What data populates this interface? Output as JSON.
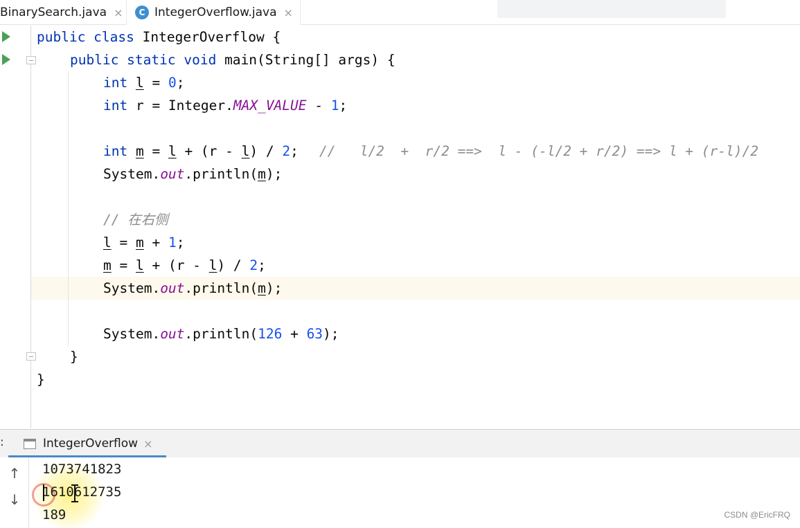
{
  "tabs": [
    {
      "label": "BinarySearch.java",
      "close": "×"
    },
    {
      "label": "IntegerOverflow.java",
      "close": "×",
      "icon": "C"
    }
  ],
  "editor": {
    "lines": [
      "public class IntegerOverflow {",
      "public static void main(String[] args) {",
      "int l = 0;",
      "int r = Integer.MAX_VALUE - 1;",
      "int m = l + (r - l) / 2;",
      "//   l/2  +  r/2 ==>  l - (-l/2 + r/2) ==> l + (r-l)/2",
      "System.out.println(m);",
      "// 在右侧",
      "l = m + 1;",
      "m = l + (r - l) / 2;",
      "System.out.println(m);",
      "System.out.println(126 + 63);",
      "}",
      "}"
    ]
  },
  "run": {
    "panel_label": ":",
    "tab_label": "IntegerOverflow",
    "tab_close": "×",
    "side_up": "↑",
    "side_down": "↓",
    "output": [
      "1073741823",
      "1610612735",
      "189"
    ]
  },
  "watermark": "CSDN @EricFRQ",
  "colors": {
    "keyword": "#0033b3",
    "number": "#1750eb",
    "field": "#871094",
    "comment": "#8c8c8c",
    "run_icon": "#4aa05a",
    "current_line": "#fdf9ec"
  }
}
